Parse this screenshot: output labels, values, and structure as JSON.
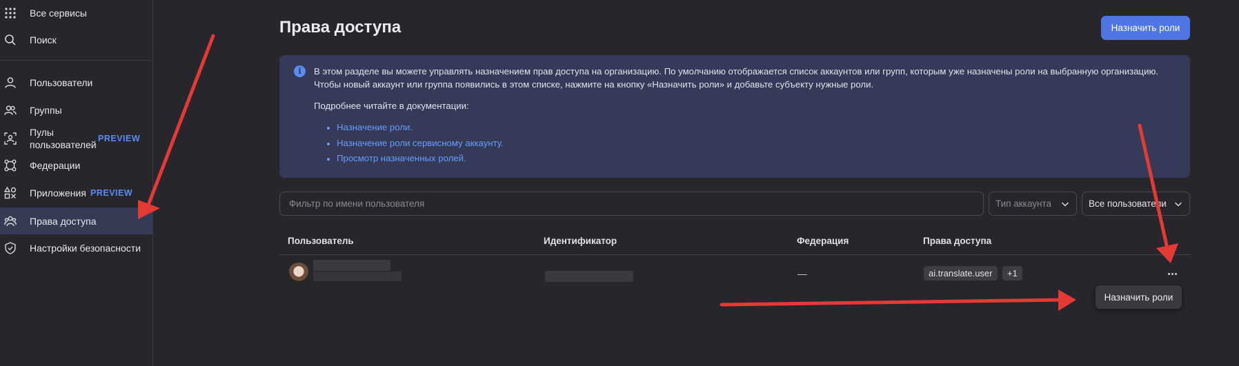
{
  "sidebar": {
    "items": [
      {
        "label": "Все сервисы",
        "icon": "grid-icon"
      },
      {
        "label": "Поиск",
        "icon": "search-icon"
      },
      {
        "label": "Пользователи",
        "icon": "user-icon"
      },
      {
        "label": "Группы",
        "icon": "users-icon"
      },
      {
        "label": "Пулы пользователей",
        "label_line1": "Пулы",
        "label_line2": "пользователей",
        "badge": "PREVIEW",
        "icon": "user-pool-icon"
      },
      {
        "label": "Федерации",
        "icon": "federation-icon"
      },
      {
        "label": "Приложения",
        "badge": "PREVIEW",
        "icon": "apps-icon"
      },
      {
        "label": "Права доступа",
        "icon": "access-rights-icon",
        "active": true
      },
      {
        "label": "Настройки безопасности",
        "icon": "shield-icon"
      }
    ]
  },
  "header": {
    "title": "Права доступа",
    "assign_button": "Назначить роли"
  },
  "info": {
    "text": "В этом разделе вы можете управлять назначением прав доступа на организацию. По умолчанию отображается список аккаунтов или групп, которым уже назначены роли на выбранную организацию. Чтобы новый аккаунт или группа появились в этом списке, нажмите на кнопку «Назначить роли» и добавьте субъекту нужные роли.",
    "more": "Подробнее читайте в документации:",
    "links": [
      "Назначение роли.",
      "Назначение роли сервисному аккаунту.",
      "Просмотр назначенных ролей."
    ]
  },
  "filters": {
    "search_placeholder": "Фильтр по имени пользователя",
    "account_type": "Тип аккаунта",
    "users": "Все пользователи"
  },
  "table": {
    "columns": [
      "Пользователь",
      "Идентификатор",
      "Федерация",
      "Права доступа"
    ],
    "rows": [
      {
        "federation": "—",
        "role": "ai.translate.user",
        "extra": "+1"
      }
    ]
  },
  "popup": {
    "label": "Назначить роли"
  },
  "colors": {
    "accent": "#4f76e3",
    "info_bg": "#343a58",
    "annotation_arrow": "#e53935"
  }
}
